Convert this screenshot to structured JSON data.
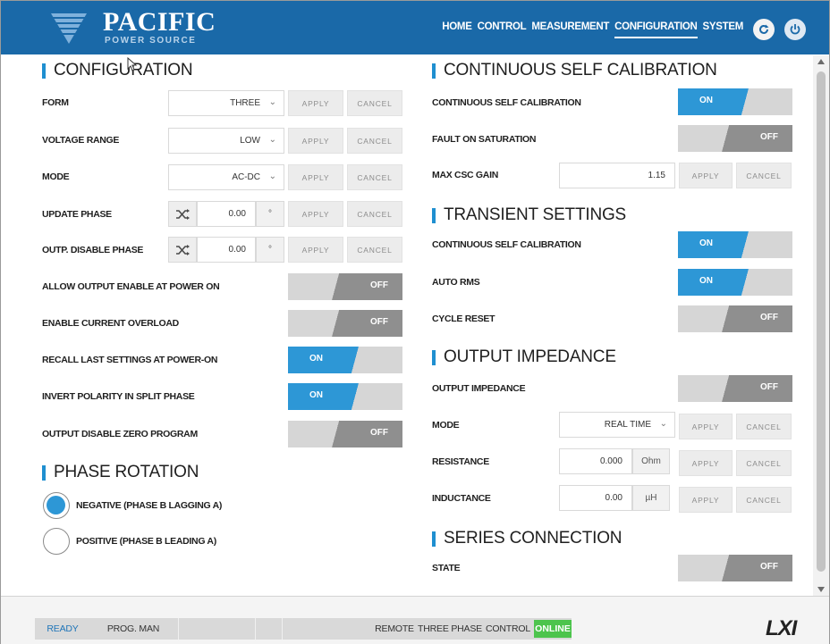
{
  "brand": {
    "name": "PACIFIC",
    "subtitle": "POWER SOURCE"
  },
  "nav": [
    {
      "label": "HOME",
      "active": false
    },
    {
      "label": "CONTROL",
      "active": false
    },
    {
      "label": "MEASUREMENT",
      "active": false
    },
    {
      "label": "CONFIGURATION",
      "active": true
    },
    {
      "label": "SYSTEM",
      "active": false
    }
  ],
  "header_icons": {
    "refresh": "refresh-icon",
    "power": "power-icon"
  },
  "colors": {
    "header": "#1a69a8",
    "accent": "#2d97d6",
    "toggle_off": "#8f8f8f",
    "online": "#4cc44c"
  },
  "buttons": {
    "apply": "APPLY",
    "cancel": "CANCEL"
  },
  "configuration": {
    "title": "CONFIGURATION",
    "form": {
      "label": "FORM",
      "value": "THREE"
    },
    "voltage_range": {
      "label": "VOLTAGE RANGE",
      "value": "LOW"
    },
    "mode": {
      "label": "MODE",
      "value": "AC-DC"
    },
    "update_phase": {
      "label": "UPDATE PHASE",
      "value": "0.00",
      "unit": "°"
    },
    "outp_disable_phase": {
      "label": "OUTP. DISABLE PHASE",
      "value": "0.00",
      "unit": "°"
    },
    "allow_output_enable": {
      "label": "ALLOW OUTPUT ENABLE AT POWER ON",
      "state": "OFF"
    },
    "enable_current_overload": {
      "label": "ENABLE CURRENT OVERLOAD",
      "state": "OFF"
    },
    "recall_last_settings": {
      "label": "RECALL LAST SETTINGS AT POWER-ON",
      "state": "ON"
    },
    "invert_polarity": {
      "label": "INVERT POLARITY IN SPLIT PHASE",
      "state": "ON"
    },
    "output_disable_zero": {
      "label": "OUTPUT DISABLE ZERO PROGRAM",
      "state": "OFF"
    }
  },
  "phase_rotation": {
    "title": "PHASE ROTATION",
    "options": [
      {
        "label": "NEGATIVE (PHASE B LAGGING A)",
        "checked": true
      },
      {
        "label": "POSITIVE (PHASE B LEADING A)",
        "checked": false
      }
    ]
  },
  "csc": {
    "title": "CONTINUOUS SELF CALIBRATION",
    "continuous": {
      "label": "CONTINUOUS SELF CALIBRATION",
      "state": "ON"
    },
    "fault_on_saturation": {
      "label": "FAULT ON SATURATION",
      "state": "OFF"
    },
    "max_gain": {
      "label": "MAX CSC GAIN",
      "value": "1.15"
    }
  },
  "transient": {
    "title": "TRANSIENT SETTINGS",
    "continuous": {
      "label": "CONTINUOUS SELF CALIBRATION",
      "state": "ON"
    },
    "auto_rms": {
      "label": "AUTO RMS",
      "state": "ON"
    },
    "cycle_reset": {
      "label": "CYCLE RESET",
      "state": "OFF"
    }
  },
  "output_impedance": {
    "title": "OUTPUT IMPEDANCE",
    "enable": {
      "label": "OUTPUT IMPEDANCE",
      "state": "OFF"
    },
    "mode": {
      "label": "MODE",
      "value": "REAL TIME"
    },
    "resistance": {
      "label": "RESISTANCE",
      "value": "0.000",
      "unit": "Ohm"
    },
    "inductance": {
      "label": "INDUCTANCE",
      "value": "0.00",
      "unit": "µH"
    }
  },
  "series": {
    "title": "SERIES CONNECTION",
    "state": {
      "label": "STATE",
      "state": "OFF"
    }
  },
  "statusbar": {
    "ready": "READY",
    "prog": "PROG. MAN",
    "remote": "REMOTE",
    "phase": "THREE PHASE",
    "control": "CONTROL",
    "online": "ONLINE",
    "logo": "LXI"
  }
}
